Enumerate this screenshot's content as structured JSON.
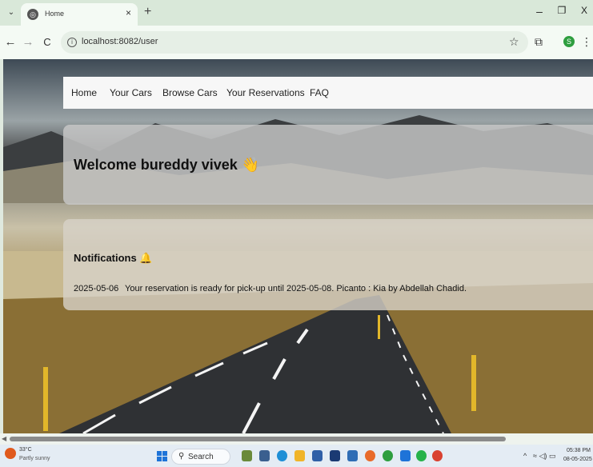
{
  "browser": {
    "tab_dropdown": "⌄",
    "tab_title": "Home",
    "tab_close": "×",
    "new_tab": "+",
    "minimize": "–",
    "restore": "❐",
    "close": "X",
    "back": "←",
    "forward": "→",
    "reload": "C",
    "url": "localhost:8082/user",
    "profile_initial": "S",
    "menu": "⋮"
  },
  "nav": {
    "items": [
      "Home",
      "Your Cars",
      "Browse Cars",
      "Your Reservations",
      "FAQ"
    ]
  },
  "welcome": {
    "text": "Welcome bureddy vivek 👋"
  },
  "notifications": {
    "title": "Notifications 🔔",
    "items": [
      {
        "date": "2025-05-06",
        "message": "Your reservation is ready for pick-up until 2025-05-08. Picanto : Kia by Abdellah Chadid."
      }
    ]
  },
  "taskbar": {
    "weather_temp": "33°C",
    "weather_desc": "Partly sunny",
    "search_label": "Search",
    "apps": [
      "file-explorer",
      "taskview",
      "edge",
      "folder",
      "store",
      "dropbox",
      "amazon",
      "firefox",
      "chrome-green",
      "app-blue",
      "whatsapp",
      "chrome"
    ],
    "app_colors": [
      "#6a8a3a",
      "#3a5f8f",
      "#1e8fd6",
      "#f0b429",
      "#2f5fa7",
      "#1b3a73",
      "#2f6db5",
      "#e86a2a",
      "#2e9e3f",
      "#1e73d8",
      "#27b24a",
      "#d94130"
    ],
    "clock_time": "05:38 PM",
    "clock_date": "08-05-2025"
  }
}
